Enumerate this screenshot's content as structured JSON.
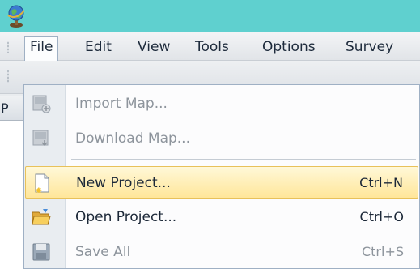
{
  "menubar": {
    "items": [
      {
        "label": "File",
        "open": true
      },
      {
        "label": "Edit"
      },
      {
        "label": "View"
      },
      {
        "label": "Tools"
      },
      {
        "label": "Options"
      },
      {
        "label": "Survey"
      }
    ]
  },
  "panel": {
    "header_label": "P"
  },
  "file_menu": {
    "items": [
      {
        "label": "Import Map...",
        "shortcut": "",
        "enabled": false,
        "icon": "import-map-icon"
      },
      {
        "label": "Download Map...",
        "shortcut": "",
        "enabled": false,
        "icon": "download-map-icon"
      },
      {
        "label": "New Project...",
        "shortcut": "Ctrl+N",
        "enabled": true,
        "highlighted": true,
        "icon": "new-project-icon"
      },
      {
        "label": "Open Project...",
        "shortcut": "Ctrl+O",
        "enabled": true,
        "icon": "open-folder-icon"
      },
      {
        "label": "Save All",
        "shortcut": "Ctrl+S",
        "enabled": false,
        "icon": "save-icon"
      }
    ]
  },
  "colors": {
    "titlebar": "#5fd0cf",
    "highlight_top": "#fff8d8",
    "highlight_bottom": "#ffe69a",
    "disabled_text": "#8d949c"
  }
}
